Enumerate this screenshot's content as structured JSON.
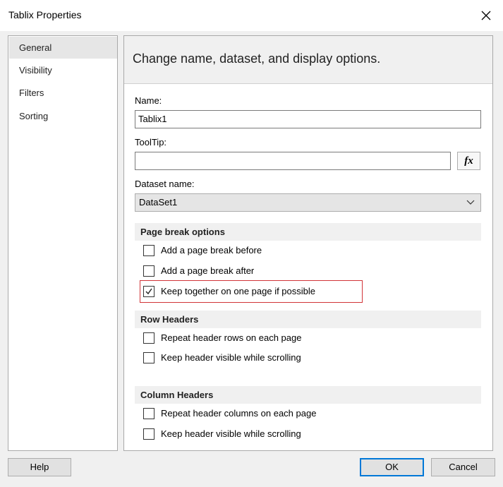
{
  "window": {
    "title": "Tablix Properties",
    "close_icon": "close-icon"
  },
  "nav": {
    "items": [
      {
        "label": "General",
        "selected": true
      },
      {
        "label": "Visibility",
        "selected": false
      },
      {
        "label": "Filters",
        "selected": false
      },
      {
        "label": "Sorting",
        "selected": false
      }
    ]
  },
  "content": {
    "heading": "Change name, dataset, and display options.",
    "name_label": "Name:",
    "name_value": "Tablix1",
    "tooltip_label": "ToolTip:",
    "tooltip_value": "",
    "fx_label": "fx",
    "dataset_label": "Dataset name:",
    "dataset_value": "DataSet1"
  },
  "sections": {
    "page_break": {
      "title": "Page break options",
      "options": [
        {
          "label": "Add a page break before",
          "checked": false
        },
        {
          "label": "Add a page break after",
          "checked": false
        },
        {
          "label": "Keep together on one page if possible",
          "checked": true
        }
      ]
    },
    "row_headers": {
      "title": "Row Headers",
      "options": [
        {
          "label": "Repeat header rows on each page",
          "checked": false
        },
        {
          "label": "Keep header visible while scrolling",
          "checked": false
        }
      ]
    },
    "column_headers": {
      "title": "Column Headers",
      "options": [
        {
          "label": "Repeat header columns on each page",
          "checked": false
        },
        {
          "label": "Keep header visible while scrolling",
          "checked": false
        }
      ]
    }
  },
  "buttons": {
    "help": "Help",
    "ok": "OK",
    "cancel": "Cancel"
  },
  "colors": {
    "highlight_border": "#d13438",
    "default_button_border": "#0078d7"
  }
}
